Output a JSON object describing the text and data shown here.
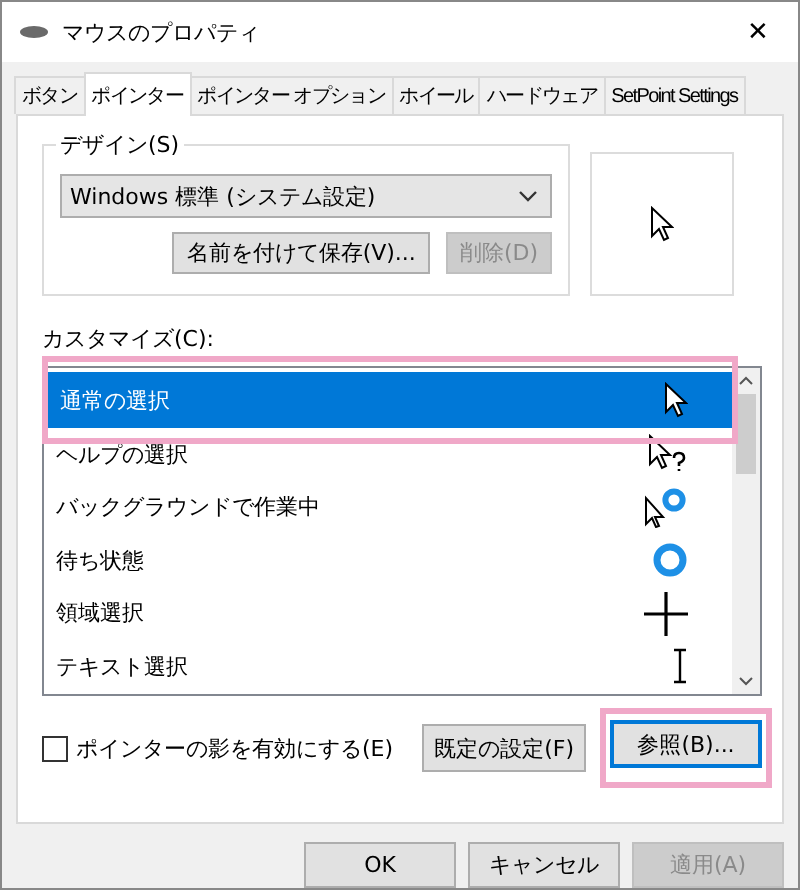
{
  "window": {
    "title": "マウスのプロパティ",
    "close": "✕"
  },
  "tabs": [
    {
      "label": "ボタン",
      "selected": false
    },
    {
      "label": "ポインター",
      "selected": true
    },
    {
      "label": "ポインター オプション",
      "selected": false
    },
    {
      "label": "ホイール",
      "selected": false
    },
    {
      "label": "ハードウェア",
      "selected": false
    },
    {
      "label": "SetPoint Settings",
      "selected": false
    }
  ],
  "design": {
    "label": "デザイン(S)",
    "value": "Windows 標準 (システム設定)",
    "save_button": {
      "label": "名前を付けて保存(V)...",
      "disabled": false
    },
    "delete_button": {
      "label": "削除(D)",
      "disabled": true
    }
  },
  "customize": {
    "label": "カスタマイズ(C):",
    "items": [
      {
        "name": "通常の選択",
        "kind": "arrow",
        "selected": true
      },
      {
        "name": "ヘルプの選択",
        "kind": "help",
        "selected": false
      },
      {
        "name": "バックグラウンドで作業中",
        "kind": "working",
        "selected": false
      },
      {
        "name": "待ち状態",
        "kind": "busy",
        "selected": false
      },
      {
        "name": "領域選択",
        "kind": "cross",
        "selected": false
      },
      {
        "name": "テキスト選択",
        "kind": "text",
        "selected": false
      }
    ]
  },
  "shadow_checkbox": {
    "label": "ポインターの影を有効にする(E)",
    "checked": false
  },
  "default_button": {
    "label": "既定の設定(F)",
    "disabled": false
  },
  "browse_button": {
    "label": "参照(B)...",
    "disabled": false,
    "highlighted": true
  },
  "footer_buttons": [
    {
      "label": "OK",
      "disabled": false
    },
    {
      "label": "キャンセル",
      "disabled": false
    },
    {
      "label": "適用(A)",
      "disabled": true
    }
  ]
}
